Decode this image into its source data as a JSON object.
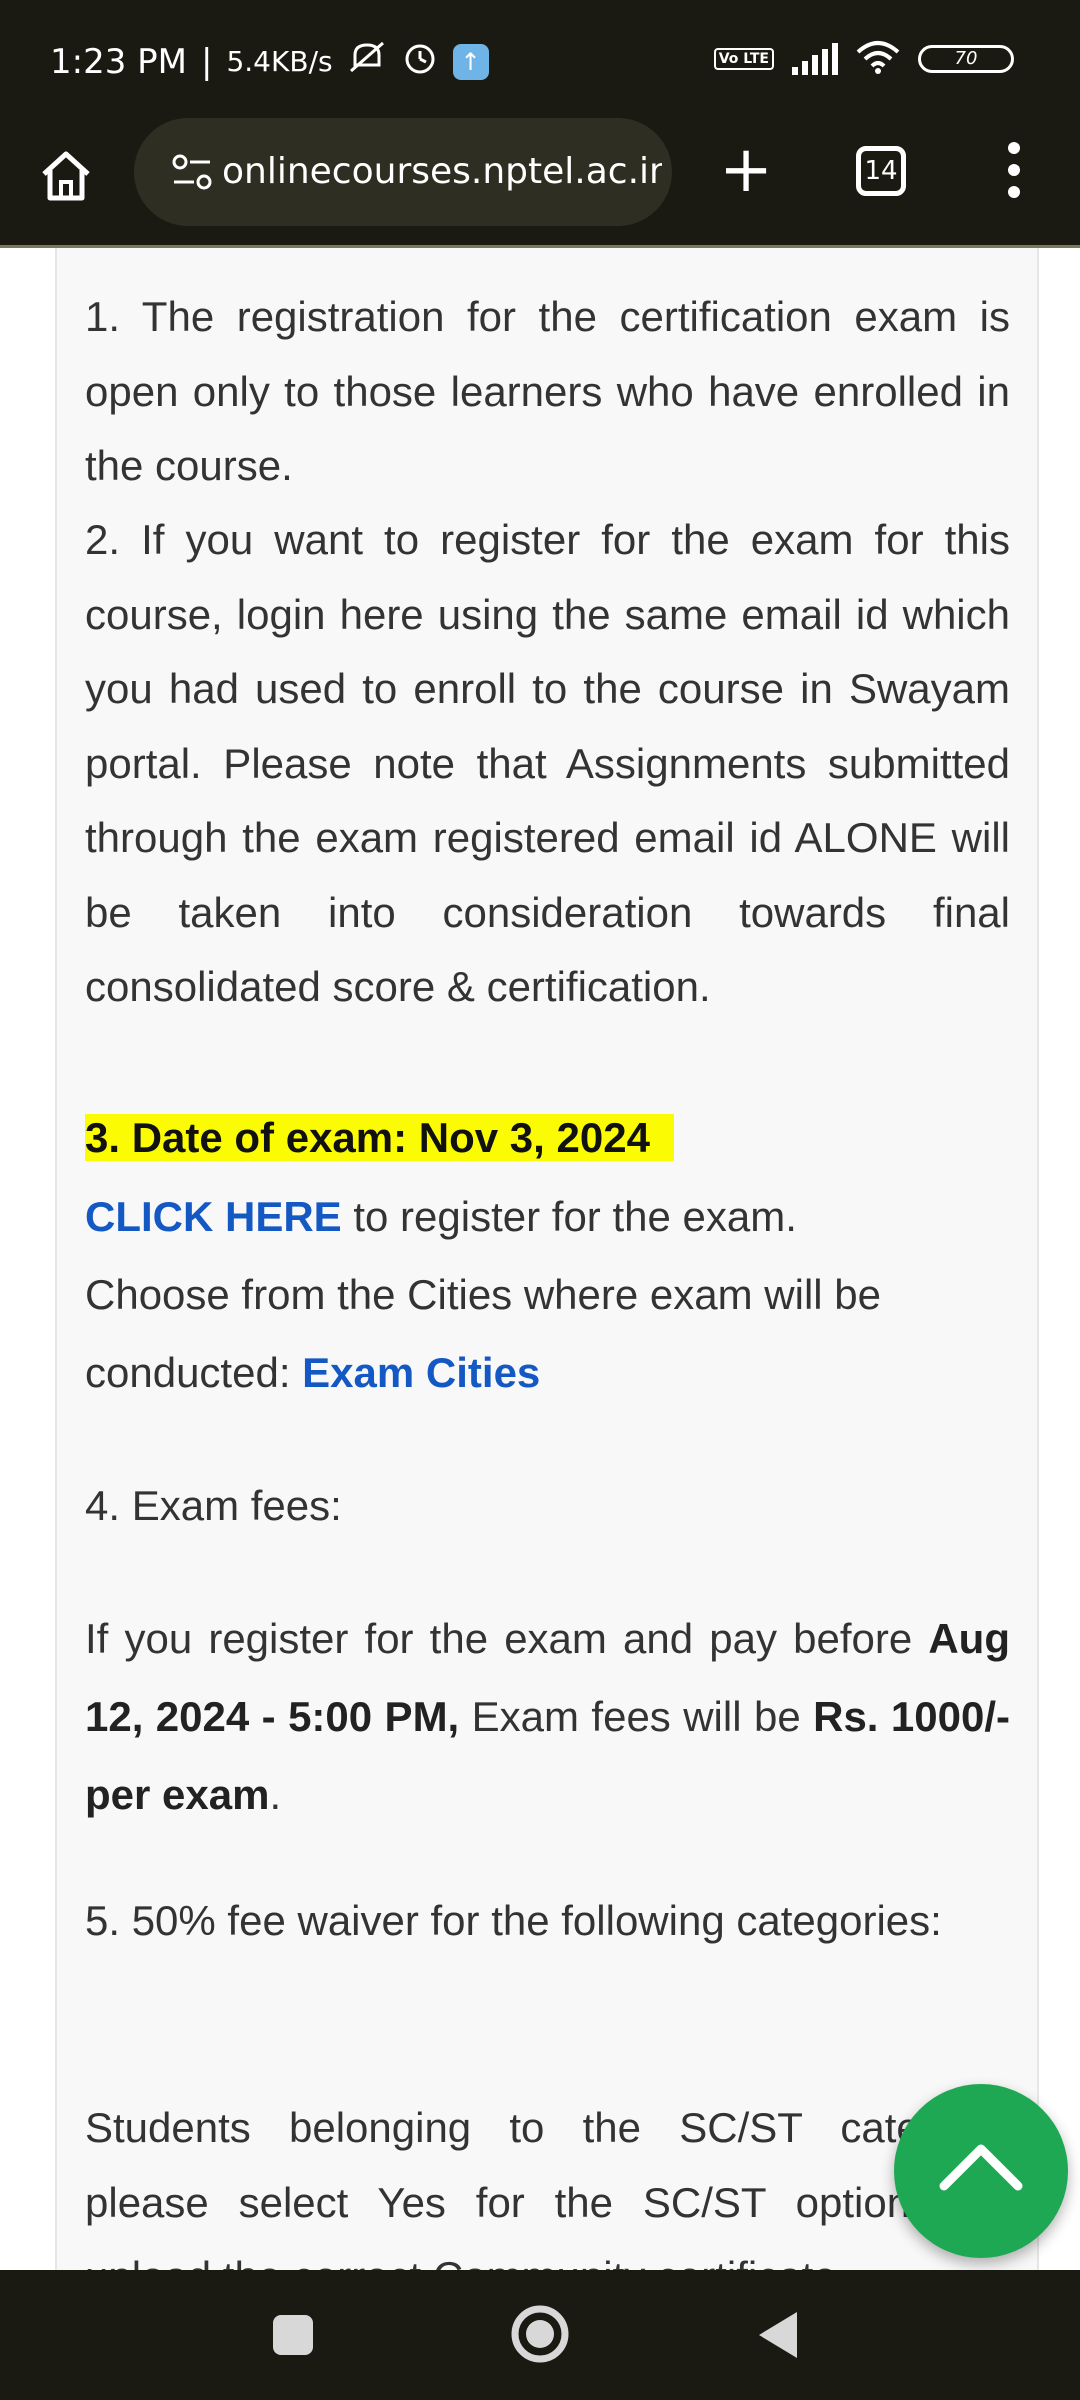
{
  "status_bar": {
    "time": "1:23 PM",
    "network_speed": "5.4KB/s",
    "battery_level": "70",
    "volte_label": "Vo LTE",
    "icons": [
      "mute-icon",
      "alarm-icon",
      "app-notification-icon",
      "volte-icon",
      "signal-icon",
      "wifi-icon",
      "battery-icon"
    ]
  },
  "toolbar": {
    "url": "onlinecourses.nptel.ac.in/no",
    "tab_count": "14",
    "new_tab_label": "+"
  },
  "content": {
    "p1": "1. The registration for the certification exam is open only to those learners who have enrolled in the course.",
    "p2": "2. If you want to register for the exam for this course, login here using the same email id which you had used to enroll to the course in Swayam portal. Please note that Assignments submitted through the exam registered email id ALONE will be taken into consideration towards final consolidated score & certification.",
    "p3_highlight": "3. Date of exam:  Nov 3, 2024",
    "click_here": "CLICK HERE",
    "click_here_rest": " to register for the exam.",
    "cities_text": "Choose from the Cities where exam will be conducted: ",
    "cities_link": "Exam Cities",
    "p4": "4. Exam fees:",
    "fees_pre": "If you register for the exam and pay before ",
    "fees_date": "Aug 12, 2024 - 5:00 PM,",
    "fees_mid": " Exam fees will be ",
    "fees_amount": "Rs. 1000/- per exam",
    "fees_end": ".",
    "p5": "5. 50% fee waiver for the following categories:",
    "p6": "Students belonging to the SC/ST category, please select Yes for the SC/ST option and upload the correct Community certificate."
  },
  "colors": {
    "link": "#1458c4",
    "highlight": "#fbfb04",
    "fab": "#1ea853",
    "bar_bg": "#1b1a12"
  }
}
